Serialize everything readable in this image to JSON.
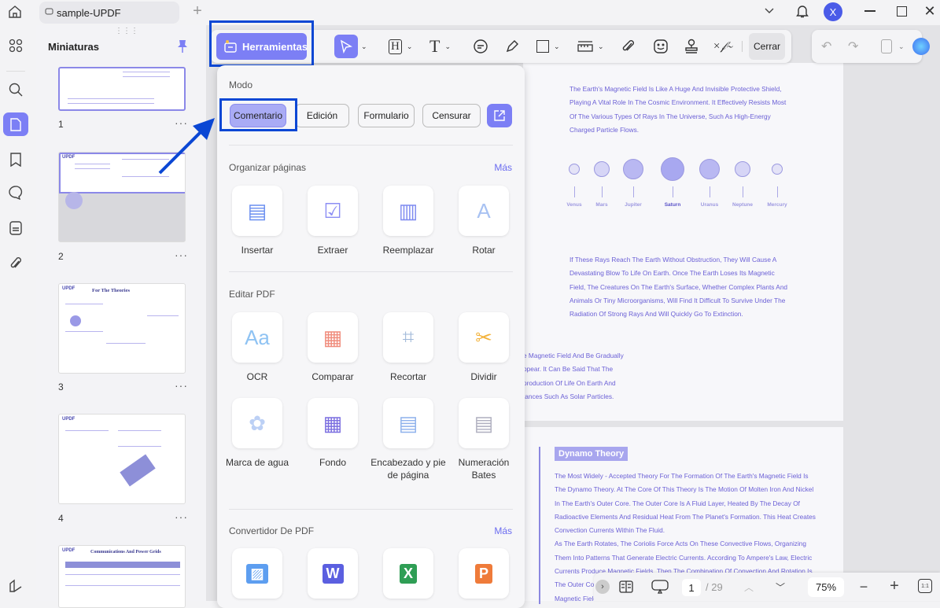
{
  "titlebar": {
    "tab_title": "sample-UPDF",
    "avatar_letter": "X"
  },
  "thumbnails": {
    "title": "Miniaturas",
    "pages": [
      "1",
      "2",
      "3",
      "4"
    ],
    "more": "···",
    "page3_heading": "For The Theories",
    "page5_heading": "Communications And Power Grids"
  },
  "toolbar": {
    "tools_label": "Herramientas",
    "close_label": "Cerrar"
  },
  "panel": {
    "mode_label": "Modo",
    "modes": [
      "Comentario",
      "Edición",
      "Formulario",
      "Censurar"
    ],
    "organize": {
      "title": "Organizar páginas",
      "more": "Más",
      "items": [
        "Insertar",
        "Extraer",
        "Reemplazar",
        "Rotar"
      ]
    },
    "edit": {
      "title": "Editar PDF",
      "items": [
        "OCR",
        "Comparar",
        "Recortar",
        "Dividir",
        "Marca de agua",
        "Fondo",
        "Encabezado y pie de página",
        "Numeración Bates"
      ]
    },
    "convert": {
      "title": "Convertidor De PDF",
      "more": "Más"
    }
  },
  "document": {
    "para1": [
      "The Earth's Magnetic Field Is Like A Huge And Invisible Protective Shield,",
      "Playing A Vital Role In The Cosmic Environment. It Effectively Resists Most",
      "Of The Various Types Of Rays In The Universe, Such As High-Energy",
      "Charged Particle Flows."
    ],
    "planets": [
      "Venus",
      "Mars",
      "Jupiter",
      "Saturn",
      "Uranus",
      "Neptune",
      "Mercury"
    ],
    "para2": [
      "If These Rays Reach The Earth Without Obstruction, They Will Cause A",
      "Devastating Blow To Life On Earth. Once The Earth Loses Its Magnetic",
      "Field, The Creatures On The Earth's Surface, Whether Complex Plants And",
      "Animals Or Tiny Microorganisms, Will Find It Difficult To Survive Under The",
      "Radiation Of Strong Rays And Will Quickly Go To Extinction."
    ],
    "para3": [
      "e Magnetic Field And Be Gradually",
      "ppear. It Can Be Said That The",
      "production Of Life On Earth And",
      "tances Such As Solar Particles."
    ],
    "dynamo_title": "Dynamo Theory",
    "para4": [
      "The Most Widely - Accepted Theory For The Formation Of The Earth's Magnetic Field Is",
      "The Dynamo Theory. At The Core Of This Theory Is The Motion Of Molten Iron And Nickel",
      "In The Earth's Outer Core. The Outer Core Is A Fluid Layer, Heated By The Decay Of",
      "Radioactive Elements And Residual Heat From The Planet's Formation. This Heat Creates",
      "Convection Currents Within The Fluid.",
      "As The Earth Rotates, The Coriolis Force Acts On These Convective Flows, Organizing",
      "Them Into Patterns That Generate Electric Currents. According To Ampere's Law, Electric",
      "Currents Produce Magnetic Fields. Then The Combination Of Convection And Rotation Is",
      "The Outer Core",
      "Magnetic Field"
    ]
  },
  "bottombar": {
    "page_current": "1",
    "page_total": "/ 29",
    "zoom": "75%",
    "fit_label": "1:1"
  },
  "colors": {
    "accent": "#7c7ff5",
    "highlight": "#0b47d4",
    "doc_text": "#6b60d6"
  }
}
